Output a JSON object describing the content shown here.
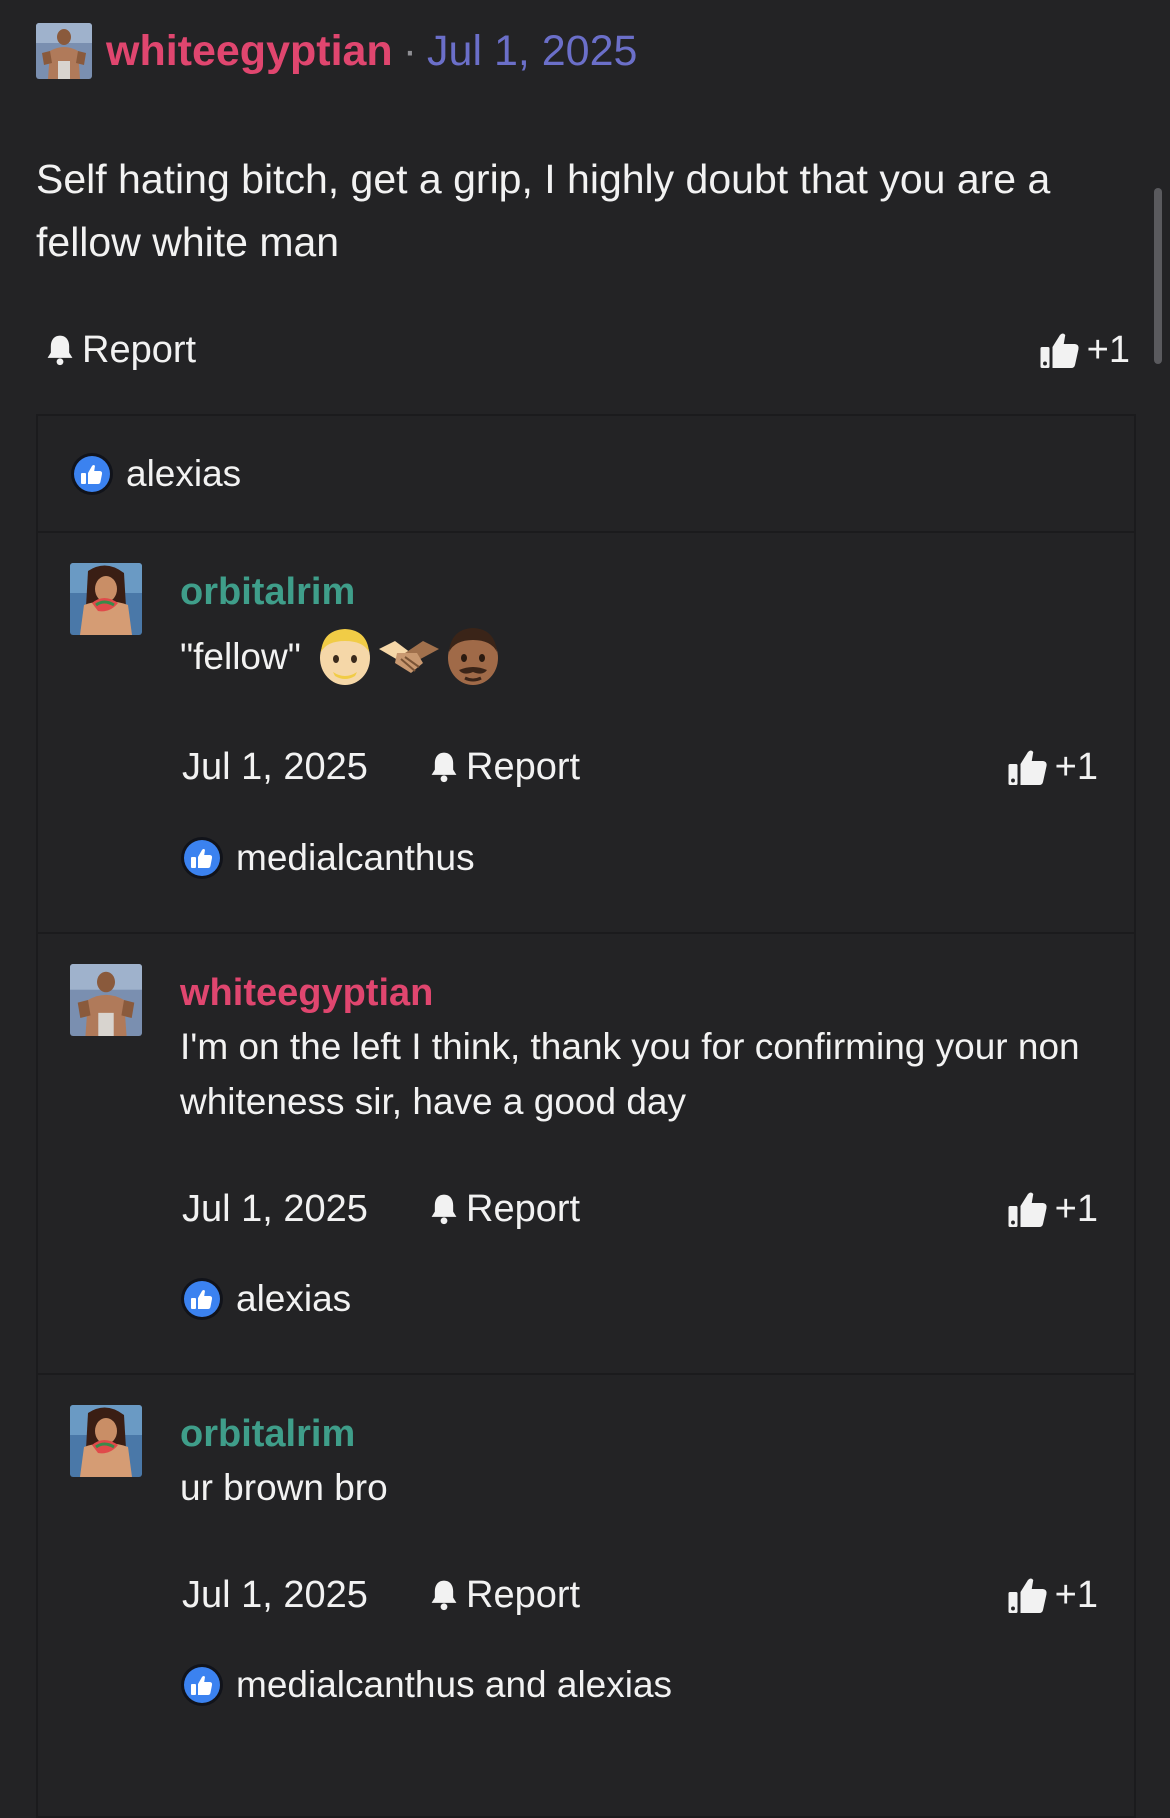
{
  "post": {
    "author": "whiteegyptian",
    "separator": "·",
    "date": "Jul 1, 2025",
    "body": "Self hating bitch, get a grip, I highly doubt that you are a fellow white man",
    "report_label": "Report",
    "like_label": "+1",
    "liked_by": "alexias"
  },
  "replies": [
    {
      "author": "orbitalrim",
      "text": "\"fellow\"",
      "emoji": [
        "blond-man-emoji",
        "handshake-emoji",
        "man-medium-dark-skin-emoji"
      ],
      "date": "Jul 1, 2025",
      "report_label": "Report",
      "like_label": "+1",
      "liked_by": "medialcanthus"
    },
    {
      "author": "whiteegyptian",
      "text": "I'm on the left I think, thank you for confirming your non whiteness sir, have a good day",
      "date": "Jul 1, 2025",
      "report_label": "Report",
      "like_label": "+1",
      "liked_by": "alexias"
    },
    {
      "author": "orbitalrim",
      "text": "ur brown bro",
      "date": "Jul 1, 2025",
      "report_label": "Report",
      "like_label": "+1",
      "liked_by": "medialcanthus and alexias"
    }
  ],
  "colors": {
    "background": "#232325",
    "author_pink": "#e0466f",
    "author_teal": "#3f9e8a",
    "date_purple": "#6b6fc9",
    "like_badge_blue": "#3b82f0"
  },
  "icons": {
    "report": "bell-icon",
    "like": "thumbs-up-icon",
    "liked_badge": "blue-thumbs-up-badge-icon"
  }
}
